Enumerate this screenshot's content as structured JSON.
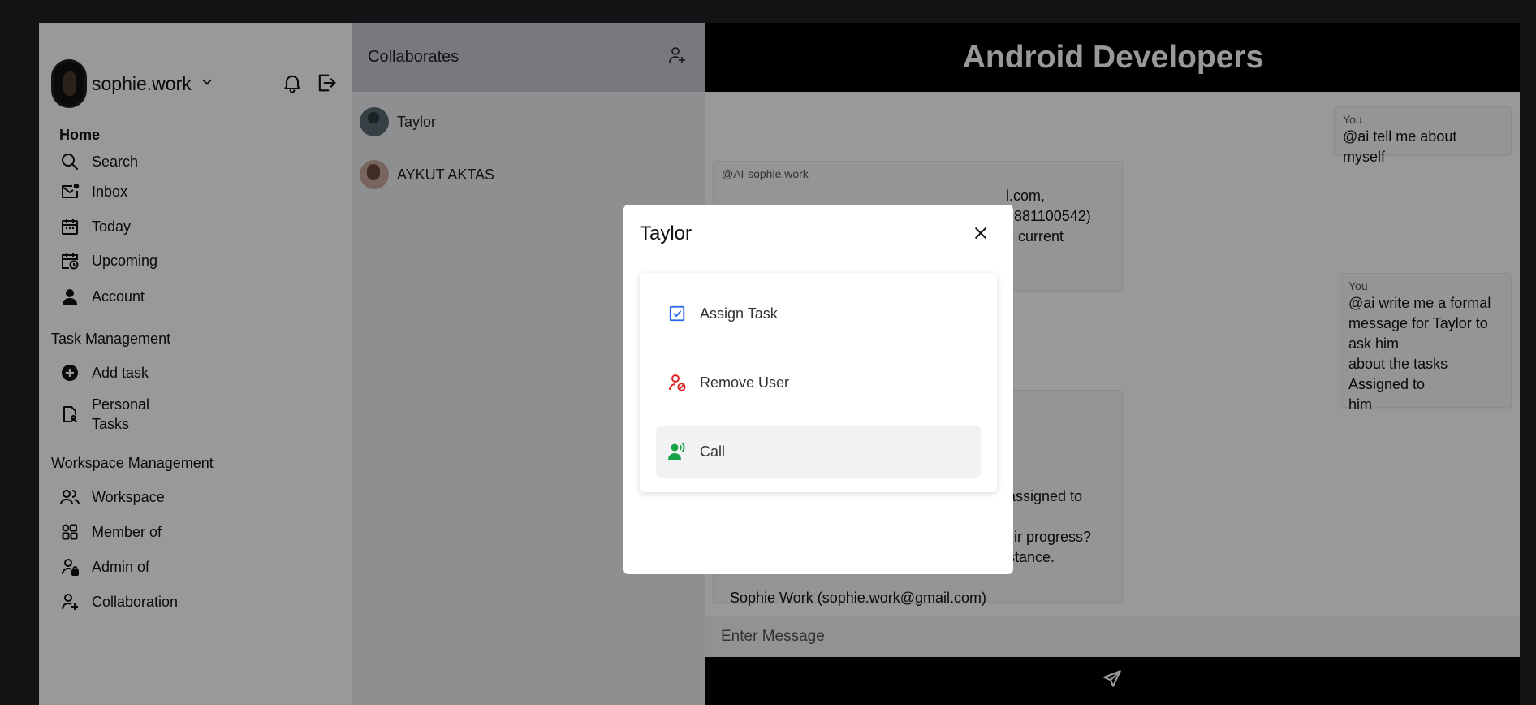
{
  "sidebar": {
    "username": "sophie.work",
    "home_label": "Home",
    "nav": {
      "search": "Search",
      "inbox": "Inbox",
      "today": "Today",
      "upcoming": "Upcoming",
      "account": "Account"
    },
    "task_section": "Task Management",
    "tasks": {
      "add_task": "Add task",
      "personal_line1": "Personal",
      "personal_line2": "Tasks"
    },
    "workspace_section": "Workspace Management",
    "workspace": {
      "workspace": "Workspace",
      "member_of": "Member of",
      "admin_of": "Admin of",
      "collaboration": "Collaboration"
    }
  },
  "collaborates": {
    "title": "Collaborates",
    "users": [
      {
        "name": "Taylor"
      },
      {
        "name": "AYKUT AKTAS"
      }
    ]
  },
  "chat": {
    "title": "Android Developers",
    "messages": [
      {
        "sender": "You",
        "text": "@ai tell me about myself"
      },
      {
        "sender": "@AI-sophie.work",
        "text_line1": "l.com, 9881100542)",
        "text_line2": "o current"
      },
      {
        "sender": "You",
        "lines": [
          "@ai write me a formal",
          "message for Taylor to ask him",
          "about the tasks Assigned to",
          "him"
        ]
      },
      {
        "lines": [
          "sks assigned to you.",
          "n their progress?",
          "assistance."
        ],
        "signature": "Sophie Work (sophie.work@gmail.com)"
      }
    ],
    "input_placeholder": "Enter Message"
  },
  "modal": {
    "title": "Taylor",
    "options": {
      "assign_task": "Assign Task",
      "remove_user": "Remove User",
      "call": "Call"
    }
  },
  "colors": {
    "assign_icon": "#2563eb",
    "remove_icon": "#dc2626",
    "call_icon": "#16a34a",
    "header_black": "#000000"
  }
}
